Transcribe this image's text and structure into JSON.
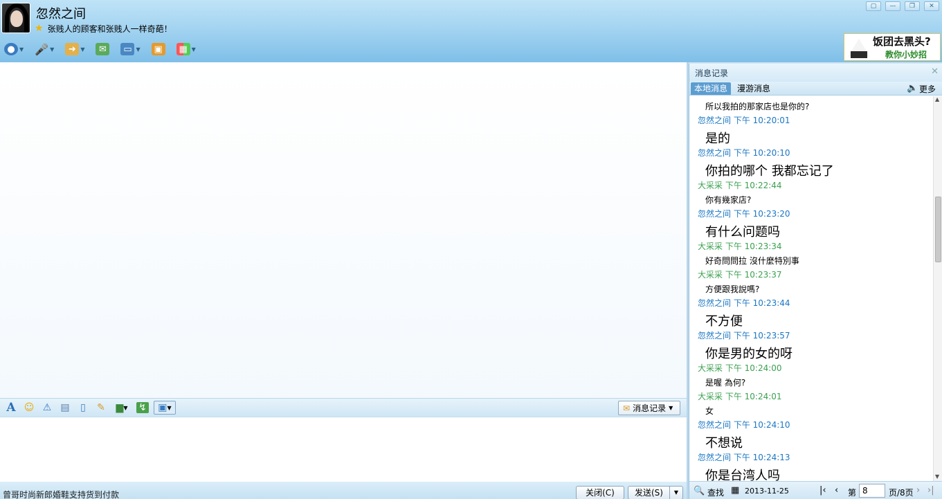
{
  "window": {
    "title": "忽然之间",
    "signature": "张贱人的顾客和张贱人一样奇葩！",
    "controls": [
      "▢",
      "—",
      "❐",
      "✕"
    ]
  },
  "toolbar": {
    "items": [
      {
        "name": "video-call",
        "icon": "webcam-icon",
        "color": "#3a7bbf"
      },
      {
        "name": "voice-call",
        "icon": "microphone-icon",
        "color": "#4a7fb0"
      },
      {
        "name": "file-transfer",
        "icon": "folder-icon",
        "color": "#d79b2c"
      },
      {
        "name": "send-sms",
        "icon": "message-icon",
        "color": "#4aa14a"
      },
      {
        "name": "remote-assist",
        "icon": "monitor-icon",
        "color": "#3a7bbf"
      },
      {
        "name": "screen-share",
        "icon": "screen-share-icon",
        "color": "#e49a2c"
      },
      {
        "name": "apps",
        "icon": "apps-grid-icon",
        "color": "#6d6"
      }
    ]
  },
  "ad": {
    "line1": "饭团去黑头?",
    "line2": "教你小妙招"
  },
  "input_toolbar": {
    "history_label": "消息记录"
  },
  "bottom": {
    "ad_text": "曾哥时尚新郎婚鞋支持货到付款",
    "close_label": "关闭(C)",
    "send_label": "发送(S)"
  },
  "history": {
    "title": "消息记录",
    "tab_local": "本地消息",
    "tab_roam": "漫游消息",
    "more_label": "更多",
    "messages": [
      {
        "type": "body",
        "size": "small",
        "text": "所以我拍的那家店也是你的?"
      },
      {
        "type": "head",
        "who": "self",
        "text": "忽然之间 下午 10:20:01"
      },
      {
        "type": "body",
        "size": "big",
        "text": "是的"
      },
      {
        "type": "head",
        "who": "self",
        "text": "忽然之间 下午 10:20:10"
      },
      {
        "type": "body",
        "size": "big",
        "text": "你拍的哪个   我都忘记了"
      },
      {
        "type": "head",
        "who": "other",
        "text": "大采采 下午 10:22:44"
      },
      {
        "type": "body",
        "size": "small",
        "text": "你有幾家店?"
      },
      {
        "type": "head",
        "who": "self",
        "text": "忽然之间 下午 10:23:20"
      },
      {
        "type": "body",
        "size": "big",
        "text": "有什么问题吗"
      },
      {
        "type": "head",
        "who": "other",
        "text": "大采采 下午 10:23:34"
      },
      {
        "type": "body",
        "size": "small",
        "text": "好奇問問拉 沒什麼特別事"
      },
      {
        "type": "head",
        "who": "other",
        "text": "大采采 下午 10:23:37"
      },
      {
        "type": "body",
        "size": "small",
        "text": "方便跟我說嗎?"
      },
      {
        "type": "head",
        "who": "self",
        "text": "忽然之间 下午 10:23:44"
      },
      {
        "type": "body",
        "size": "big",
        "text": "不方便"
      },
      {
        "type": "head",
        "who": "self",
        "text": "忽然之间 下午 10:23:57"
      },
      {
        "type": "body",
        "size": "big",
        "text": "你是男的女的呀"
      },
      {
        "type": "head",
        "who": "other",
        "text": "大采采 下午 10:24:00"
      },
      {
        "type": "body",
        "size": "small",
        "text": "是喔 為何?"
      },
      {
        "type": "head",
        "who": "other",
        "text": "大采采 下午 10:24:01"
      },
      {
        "type": "body",
        "size": "small",
        "text": "女"
      },
      {
        "type": "head",
        "who": "self",
        "text": "忽然之间 下午 10:24:10"
      },
      {
        "type": "body",
        "size": "big",
        "text": "不想说"
      },
      {
        "type": "head",
        "who": "self",
        "text": "忽然之间 下午 10:24:13"
      },
      {
        "type": "body",
        "size": "big",
        "text": "你是台湾人吗"
      }
    ],
    "footer": {
      "search_label": "查找",
      "date": "2013-11-25",
      "page_prefix": "第",
      "page_value": "8",
      "page_suffix": "页/8页"
    }
  }
}
